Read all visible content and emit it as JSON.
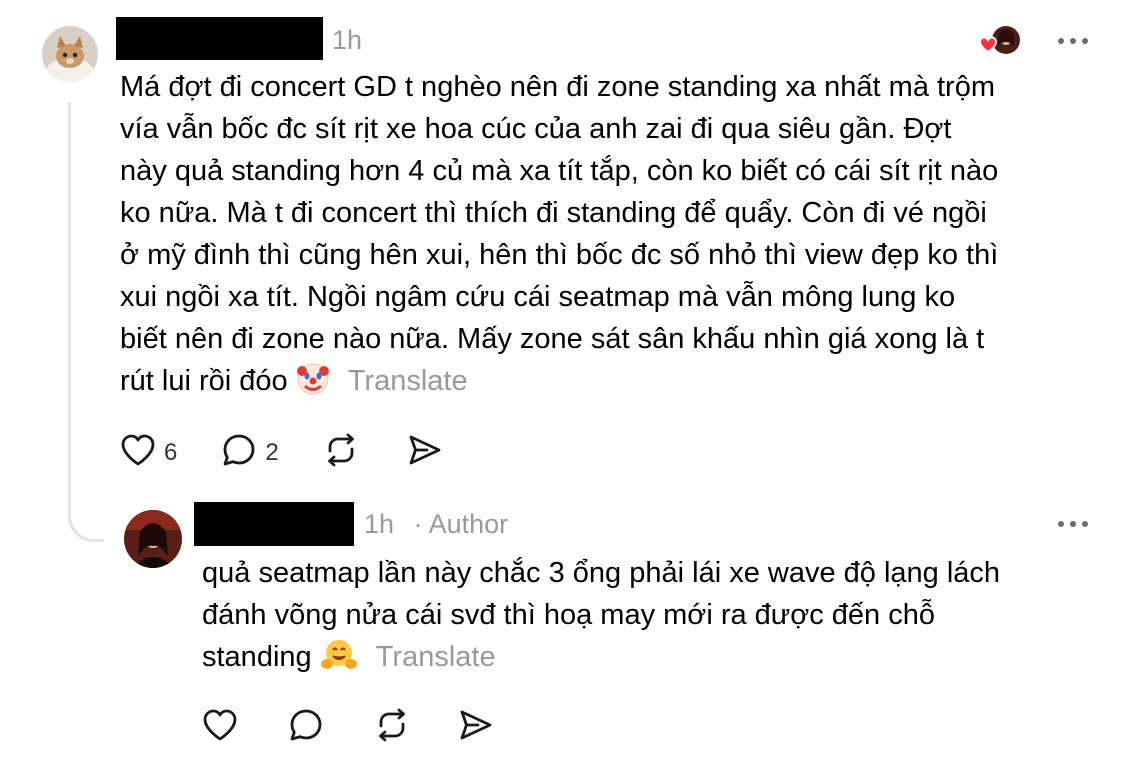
{
  "comment": {
    "timestamp": "1h",
    "text": "Má đợt đi concert GD t nghèo nên đi zone standing xa nhất mà trộm vía vẫn bốc đc sít rịt xe hoa cúc của anh zai đi qua siêu gần. Đợt này quả standing hơn 4 củ mà xa tít tắp, còn ko biết có cái sít rịt nào ko nữa. Mà t đi concert thì thích đi standing để quẩy. Còn đi vé ngồi ở mỹ đình thì cũng hên xui, hên thì bốc đc số nhỏ thì view đẹp ko thì xui ngồi xa tít. Ngồi ngâm cứu cái seatmap mà vẫn mông lung ko biết nên đi zone nào nữa. Mấy zone sát sân khấu nhìn giá xong là t rút lui rồi đóo",
    "emoji": "clown-face",
    "translate_label": "Translate",
    "like_count": "6",
    "reply_count": "2",
    "liked_by_author": true
  },
  "reply": {
    "timestamp": "1h",
    "author_tag": "· Author",
    "text": "quả seatmap lần này chắc 3 ổng phải lái xe wave độ lạng lách đánh võng nửa cái svđ thì hoạ may mới ra được đến chỗ standing",
    "emoji": "hugging-face",
    "translate_label": "Translate"
  },
  "colors": {
    "text": "#000000",
    "muted": "#999999",
    "like_red": "#ff3040",
    "thread_line": "#e3e3e3"
  }
}
